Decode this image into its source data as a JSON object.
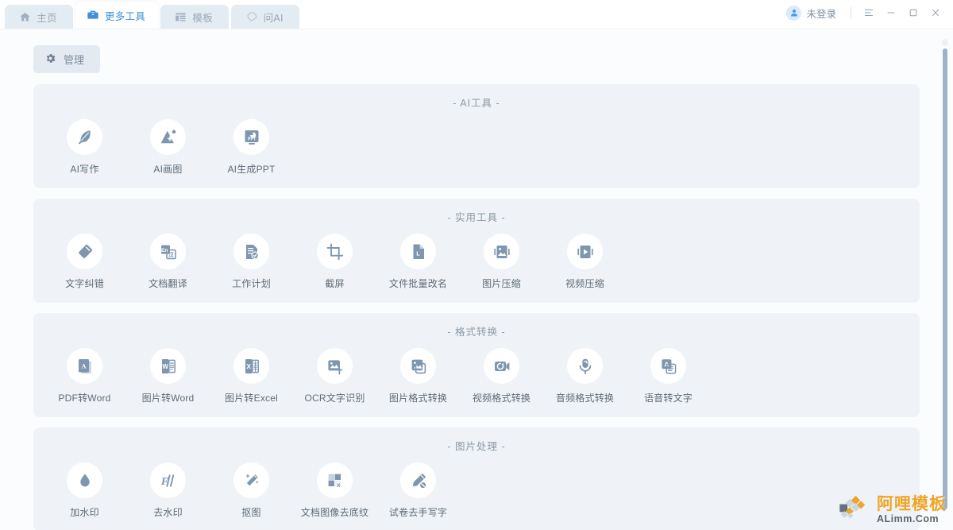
{
  "titlebar": {
    "tabs": [
      {
        "label": "主页",
        "icon": "home-icon",
        "active": false
      },
      {
        "label": "更多工具",
        "icon": "briefcase-icon",
        "active": true
      },
      {
        "label": "模板",
        "icon": "template-icon",
        "active": false
      },
      {
        "label": "问AI",
        "icon": "ai-chat-icon",
        "active": false
      }
    ],
    "account_label": "未登录",
    "account_icon": "user-icon",
    "window_buttons": [
      {
        "name": "menu-button",
        "glyph": "menu-icon"
      },
      {
        "name": "minimize-button",
        "glyph": "minimize-icon"
      },
      {
        "name": "maximize-button",
        "glyph": "maximize-icon"
      },
      {
        "name": "close-button",
        "glyph": "close-icon"
      }
    ]
  },
  "toolbar": {
    "manage_label": "管理",
    "manage_icon": "gear-icon"
  },
  "sections": [
    {
      "title": "- AI工具 -",
      "tools": [
        {
          "label": "AI写作",
          "icon": "feather-pen-icon"
        },
        {
          "label": "AI画图",
          "icon": "ai-image-icon"
        },
        {
          "label": "AI生成PPT",
          "icon": "ppt-icon"
        }
      ]
    },
    {
      "title": "- 实用工具 -",
      "tools": [
        {
          "label": "文字纠错",
          "icon": "eraser-icon"
        },
        {
          "label": "文档翻译",
          "icon": "translate-icon"
        },
        {
          "label": "工作计划",
          "icon": "checklist-icon"
        },
        {
          "label": "截屏",
          "icon": "crop-icon"
        },
        {
          "label": "文件批量改名",
          "icon": "file-rename-icon"
        },
        {
          "label": "图片压缩",
          "icon": "image-compress-icon"
        },
        {
          "label": "视频压缩",
          "icon": "video-compress-icon"
        }
      ]
    },
    {
      "title": "- 格式转换 -",
      "tools": [
        {
          "label": "PDF转Word",
          "icon": "pdf-icon"
        },
        {
          "label": "图片转Word",
          "icon": "word-icon"
        },
        {
          "label": "图片转Excel",
          "icon": "excel-icon"
        },
        {
          "label": "OCR文字识别",
          "icon": "ocr-icon"
        },
        {
          "label": "图片格式转换",
          "icon": "image-convert-icon"
        },
        {
          "label": "视频格式转换",
          "icon": "video-convert-icon"
        },
        {
          "label": "音频格式转换",
          "icon": "audio-convert-icon"
        },
        {
          "label": "语音转文字",
          "icon": "speech-to-text-icon"
        }
      ]
    },
    {
      "title": "- 图片处理 -",
      "tools": [
        {
          "label": "加水印",
          "icon": "watermark-add-icon"
        },
        {
          "label": "去水印",
          "icon": "watermark-remove-icon"
        },
        {
          "label": "抠图",
          "icon": "magic-wand-icon"
        },
        {
          "label": "文档图像去底纹",
          "icon": "remove-shading-icon"
        },
        {
          "label": "试卷去手写字",
          "icon": "remove-handwriting-icon"
        }
      ]
    }
  ],
  "watermark": {
    "cn": "阿哩模板",
    "en": "ALimm.Com",
    "logo_icon": "alimm-logo-icon",
    "color": "#f0a020"
  },
  "colors": {
    "accent": "#3d8fe0",
    "card_bg": "#eff3f7",
    "icon_blue_gray": "#7e97ae",
    "text": "#5f6b77"
  }
}
